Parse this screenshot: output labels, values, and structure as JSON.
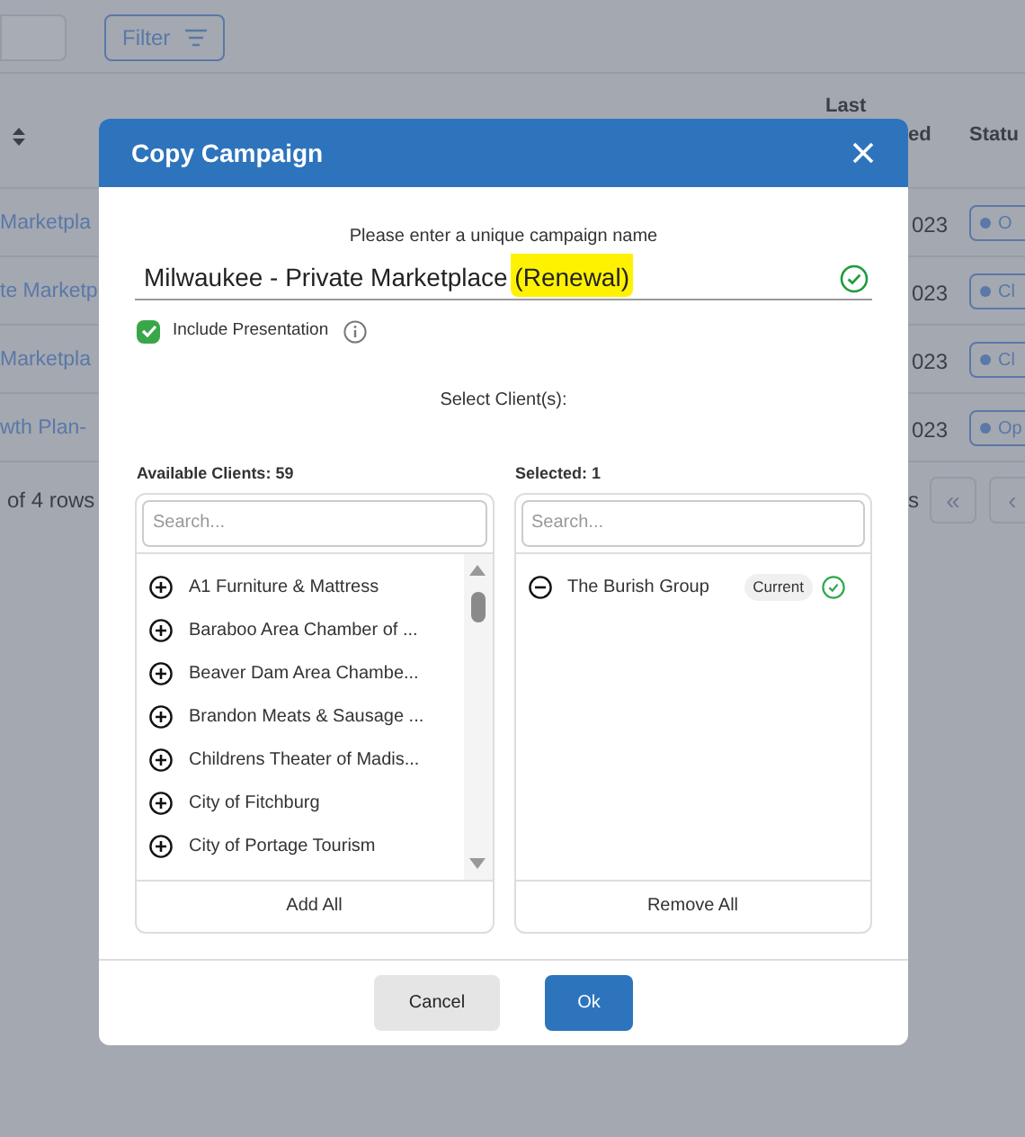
{
  "page": {
    "filter_button": "Filter",
    "header_last": "Last",
    "header_ed": "ed",
    "header_status": "Statu",
    "rows": [
      {
        "name": "Marketpla",
        "date": "023",
        "status": "O"
      },
      {
        "name": "te Marketp",
        "date": "023",
        "status": "Cl"
      },
      {
        "name": "Marketpla",
        "date": "023",
        "status": "Cl"
      },
      {
        "name": "wth Plan-",
        "date": "023",
        "status": "Op"
      }
    ],
    "rows_info": "of 4 rows",
    "pager_label": "s",
    "pager_buttons": [
      "«",
      "‹"
    ]
  },
  "dialog": {
    "title": "Copy Campaign",
    "name_label": "Please enter a unique campaign name",
    "name_value": "Milwaukee - Private Marketplace (Renewal)",
    "name_valid": true,
    "include_presentation": {
      "label": "Include Presentation",
      "checked": true
    },
    "select_label": "Select Client(s):",
    "available": {
      "title": "Available Clients: 59",
      "placeholder": "Search...",
      "items": [
        "A1 Furniture & Mattress",
        "Baraboo Area Chamber of ...",
        "Beaver Dam Area Chambe...",
        "Brandon Meats & Sausage ...",
        "Childrens Theater of Madis...",
        "City of Fitchburg",
        "City of Portage Tourism"
      ],
      "footer": "Add All"
    },
    "selected": {
      "title": "Selected: 1",
      "placeholder": "Search...",
      "items": [
        {
          "name": "The Burish Group",
          "badge": "Current"
        }
      ],
      "footer": "Remove All"
    },
    "buttons": [
      {
        "label": "Cancel",
        "kind": "secondary"
      },
      {
        "label": "Ok",
        "kind": "primary"
      }
    ]
  }
}
